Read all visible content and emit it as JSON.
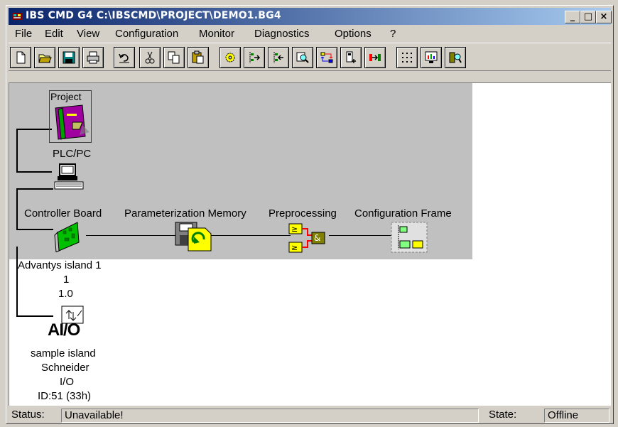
{
  "window": {
    "title": "IBS CMD G4 C:\\IBSCMD\\PROJECT\\DEMO1.BG4",
    "minimize": "_",
    "maximize": "□",
    "close": "×"
  },
  "menu": [
    "File",
    "Edit",
    "View",
    "Configuration",
    "Monitor",
    "Diagnostics",
    "Options",
    "?"
  ],
  "toolbar": {
    "icons": [
      "new-file-icon",
      "open-folder-icon",
      "save-disk-icon",
      "print-icon",
      "undo-icon",
      "cut-icon",
      "copy-icon",
      "paste-icon",
      "settings-gear-icon",
      "read-config-icon",
      "write-config-icon",
      "search-icon",
      "compare-icon",
      "device-add-icon",
      "transfer-icon",
      "grid-icon",
      "monitor-icon",
      "diagnostics-icon"
    ]
  },
  "tree": {
    "project_label": "Project",
    "plc_label": "PLC/PC",
    "controller_label": "Controller Board",
    "param_memory_label": "Parameterization Memory",
    "preprocessing_label": "Preprocessing",
    "config_frame_label": "Configuration Frame",
    "island": {
      "name": "Advantys island 1",
      "line1": "1",
      "line2": "1.0"
    },
    "device": {
      "icon_text": "AI/O",
      "name": "sample island",
      "vendor": "Schneider",
      "type": "I/O",
      "id": "ID:51 (33h)"
    }
  },
  "status": {
    "status_label": "Status:",
    "status_value": "Unavailable!",
    "state_label": "State:",
    "state_value": "Offline"
  }
}
